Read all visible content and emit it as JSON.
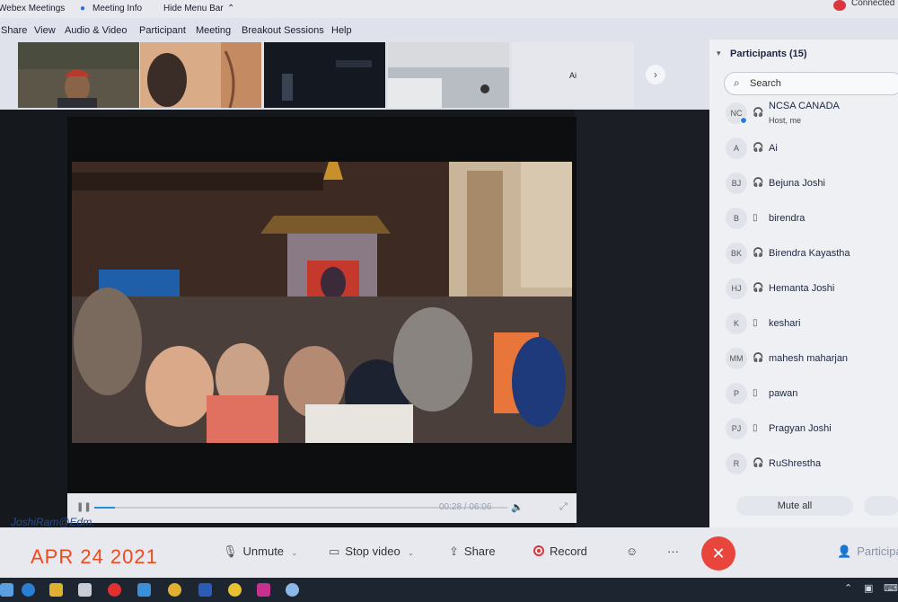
{
  "titlebar": {
    "app": "Webex Meetings",
    "meeting_info": "Meeting Info",
    "hide_menu": "Hide Menu Bar",
    "status": "Connected"
  },
  "menu": [
    "Share",
    "View",
    "Audio & Video",
    "Participant",
    "Meeting",
    "Breakout Sessions",
    "Help"
  ],
  "thumbnails": {
    "ai_label": "Ai"
  },
  "video": {
    "time": "00:28 / 06:06",
    "progress": 0.05
  },
  "participants": {
    "title": "Participants (15)",
    "search_placeholder": "Search",
    "list": [
      {
        "initials": "NC",
        "name": "NCSA CANADA",
        "subtitle": "Host, me",
        "device": "audio"
      },
      {
        "initials": "A",
        "name": "Ai",
        "device": "audio"
      },
      {
        "initials": "BJ",
        "name": "Bejuna Joshi",
        "device": "audio"
      },
      {
        "initials": "B",
        "name": "birendra",
        "device": "phone"
      },
      {
        "initials": "BK",
        "name": "Birendra Kayastha",
        "device": "audio"
      },
      {
        "initials": "HJ",
        "name": "Hemanta Joshi",
        "device": "audio"
      },
      {
        "initials": "K",
        "name": "keshari",
        "device": "phone"
      },
      {
        "initials": "MM",
        "name": "mahesh maharjan",
        "device": "audio"
      },
      {
        "initials": "P",
        "name": "pawan",
        "device": "phone"
      },
      {
        "initials": "PJ",
        "name": "Pragyan Joshi",
        "device": "phone"
      },
      {
        "initials": "R",
        "name": "RuShrestha",
        "device": "audio"
      }
    ],
    "mute_all": "Mute all"
  },
  "controls": {
    "unmute": "Unmute",
    "stop_video": "Stop video",
    "share": "Share",
    "record": "Record",
    "participants": "Participants"
  },
  "overlay": {
    "watermark": "JoshiRam@Edm.",
    "date": "APR 24 2021"
  },
  "colors": {
    "accent": "#1f8de0",
    "end": "#e8453c",
    "date": "#f04a1c"
  }
}
